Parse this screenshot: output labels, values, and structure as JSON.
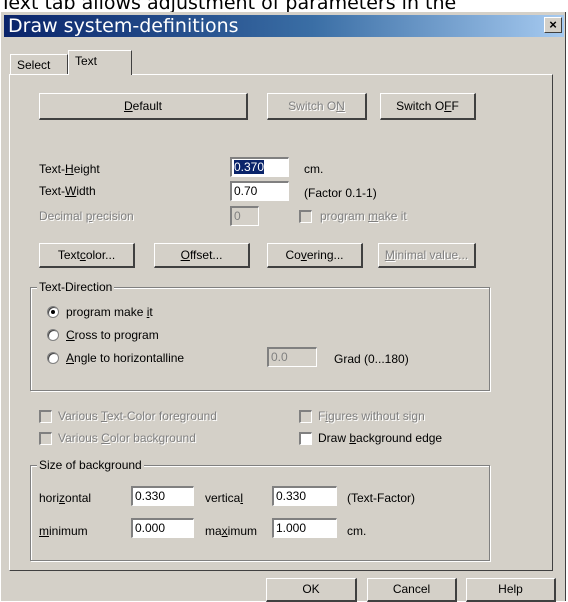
{
  "caption": "Text tab allows adjustment of parameters in the",
  "window": {
    "title": "Draw system-definitions",
    "close_label": "×"
  },
  "tabs": [
    {
      "label": "Select"
    },
    {
      "label": "Text"
    }
  ],
  "buttons_top": {
    "default": {
      "pre": "",
      "key": "D",
      "post": "efault"
    },
    "switch_on": {
      "pre": "Switch O",
      "key": "N",
      "post": ""
    },
    "switch_off": {
      "pre": "Switch O",
      "key": "F",
      "post": "F"
    }
  },
  "text_height": {
    "pre": "Text-",
    "key": "H",
    "post": "eight",
    "value": "0.370",
    "unit": "cm."
  },
  "text_width": {
    "pre": "Text-",
    "key": "W",
    "post": "idth",
    "value": "0.70",
    "hint": "(Factor 0.1-1)"
  },
  "decimal": {
    "pre": "Decimal ",
    "key": "p",
    "post": "recision",
    "value": "0"
  },
  "program_make_check": {
    "pre": "program ",
    "key": "m",
    "post": "ake it"
  },
  "mid_buttons": {
    "textcolor": {
      "pre": "Text",
      "key": "c",
      "post": "olor..."
    },
    "offset": {
      "pre": "",
      "key": "O",
      "post": "ffset..."
    },
    "covering": {
      "pre": "Co",
      "key": "v",
      "post": "ering..."
    },
    "minimal": {
      "pre": "",
      "key": "M",
      "post": "inimal value..."
    }
  },
  "text_direction": {
    "title": "Text-Direction",
    "option1": {
      "pre": "program make ",
      "key": "i",
      "post": "t"
    },
    "option2": {
      "pre": "",
      "key": "C",
      "post": "ross to program"
    },
    "option3": {
      "pre": "",
      "key": "A",
      "post": "ngle to horizontalline"
    },
    "angle_value": "0.0",
    "angle_unit": "Grad (0...180)"
  },
  "checks": {
    "various_text": {
      "pre": "Various ",
      "key": "T",
      "post": "ext-Color foreground"
    },
    "various_color": {
      "pre": "Various ",
      "key": "C",
      "post": "olor background"
    },
    "figures": {
      "pre": "F",
      "key": "i",
      "post": "gures without sign"
    },
    "draw_bg": {
      "pre": "Draw ",
      "key": "b",
      "post": "ackground edge"
    }
  },
  "background": {
    "title": "Size of background",
    "horizontal": {
      "pre": "hori",
      "key": "z",
      "post": "ontal",
      "value": "0.330"
    },
    "vertical": {
      "pre": "vertica",
      "key": "l",
      "post": "",
      "value": "0.330"
    },
    "factor": "(Text-Factor)",
    "minimum": {
      "pre": "",
      "key": "m",
      "post": "inimum",
      "value": "0.000"
    },
    "maximum": {
      "pre": "ma",
      "key": "x",
      "post": "imum",
      "value": "1.000"
    },
    "unit": "cm."
  },
  "footer": {
    "ok": "OK",
    "cancel": "Cancel",
    "help": "Help"
  }
}
